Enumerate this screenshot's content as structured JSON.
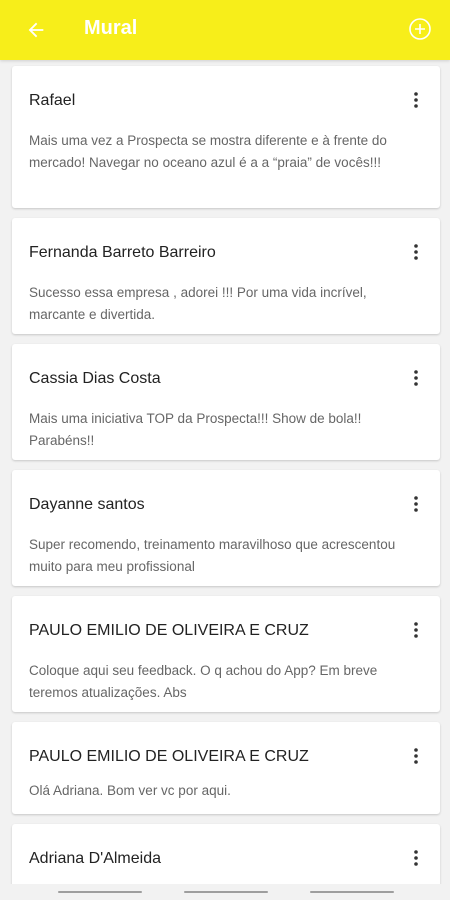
{
  "header": {
    "title": "Mural",
    "back_icon": "arrow-back-icon",
    "add_icon": "add-circle-icon",
    "bg_color": "#f7ee1a"
  },
  "posts": [
    {
      "author": "Rafael",
      "message": "Mais uma vez a Prospecta se mostra diferente e à frente do mercado! Navegar no oceano azul é a a “praia” de vocês!!!"
    },
    {
      "author": "Fernanda Barreto Barreiro",
      "message": "Sucesso essa empresa , adorei !!! Por uma vida incrível, marcante e divertida."
    },
    {
      "author": "Cassia Dias Costa",
      "message": "Mais uma iniciativa TOP da Prospecta!!! Show de bola!! Parabéns!!"
    },
    {
      "author": "Dayanne santos",
      "message": "Super recomendo, treinamento maravilhoso que acrescentou muito para meu profissional"
    },
    {
      "author": "PAULO EMILIO DE OLIVEIRA E CRUZ",
      "message": "Coloque aqui seu feedback. O q achou do App? Em breve teremos atualizações. Abs"
    },
    {
      "author": "PAULO EMILIO DE OLIVEIRA E CRUZ",
      "message": "Olá Adriana. Bom ver vc por aqui."
    },
    {
      "author": "Adriana D'Almeida",
      "message": ""
    }
  ]
}
